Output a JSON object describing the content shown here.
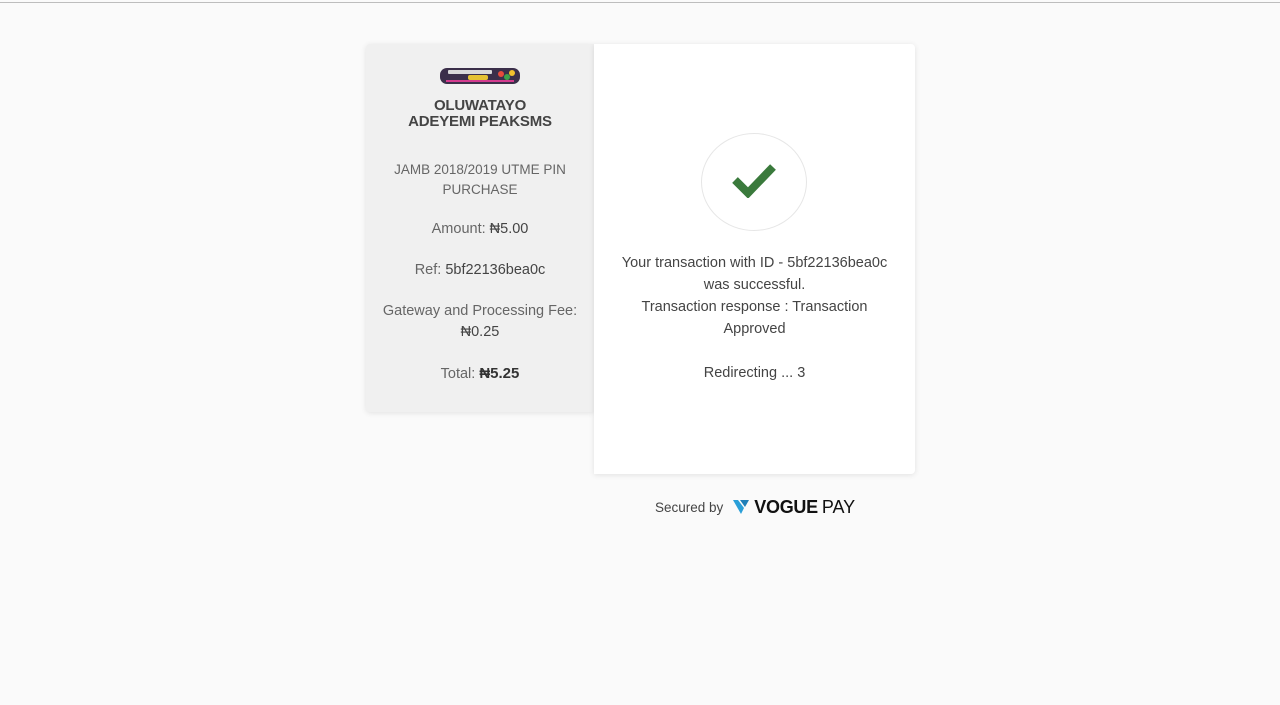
{
  "merchant": {
    "name_line1": "OLUWATAYO",
    "name_line2": "ADEYEMI PEAKSMS",
    "description": "JAMB 2018/2019 UTME PIN PURCHASE",
    "amount_label": "Amount:",
    "amount_value": "₦5.00",
    "ref_label": "Ref:",
    "ref_value": "5bf22136bea0c",
    "fee_label": "Gateway and Processing Fee:",
    "fee_value": "₦0.25",
    "total_label": "Total:",
    "total_value": "₦5.25"
  },
  "status": {
    "line1": "Your transaction with ID - 5bf22136bea0c",
    "line2": "was successful.",
    "line3": "Transaction response : Transaction",
    "line4": "Approved",
    "redirecting": "Redirecting ... 3",
    "icon": "checkmark-icon",
    "check_color": "#3a7a3c"
  },
  "footer": {
    "secured_by": "Secured by",
    "brand_bold": "VOGUE",
    "brand_light": "PAY",
    "brand_icon": "voguepay-logo-icon",
    "brand_color": "#2a9fd8"
  }
}
